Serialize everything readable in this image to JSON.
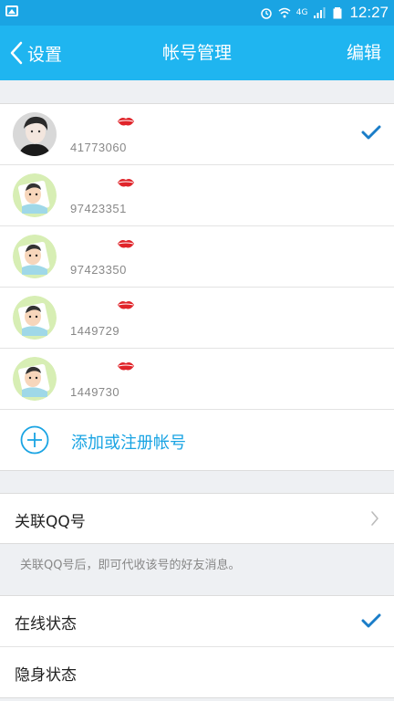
{
  "status_bar": {
    "network": "4G",
    "time": "12:27"
  },
  "header": {
    "back_label": "设置",
    "title": "帐号管理",
    "edit_label": "编辑"
  },
  "accounts": [
    {
      "number": "41773060",
      "avatar": "boy-photo",
      "selected": true
    },
    {
      "number": "97423351",
      "avatar": "cartoon-baby",
      "selected": false
    },
    {
      "number": "97423350",
      "avatar": "cartoon-baby",
      "selected": false
    },
    {
      "number": "1449729",
      "avatar": "cartoon-baby",
      "selected": false
    },
    {
      "number": "1449730",
      "avatar": "cartoon-baby",
      "selected": false
    }
  ],
  "add_account_label": "添加或注册帐号",
  "link_qq": {
    "label": "关联QQ号",
    "hint": "关联QQ号后，即可代收该号的好友消息。"
  },
  "status_options": [
    {
      "label": "在线状态",
      "selected": true
    },
    {
      "label": "隐身状态",
      "selected": false
    }
  ],
  "colors": {
    "accent": "#1aa4e3",
    "navbar": "#1fb5f0",
    "kiss": "#e0242a"
  }
}
